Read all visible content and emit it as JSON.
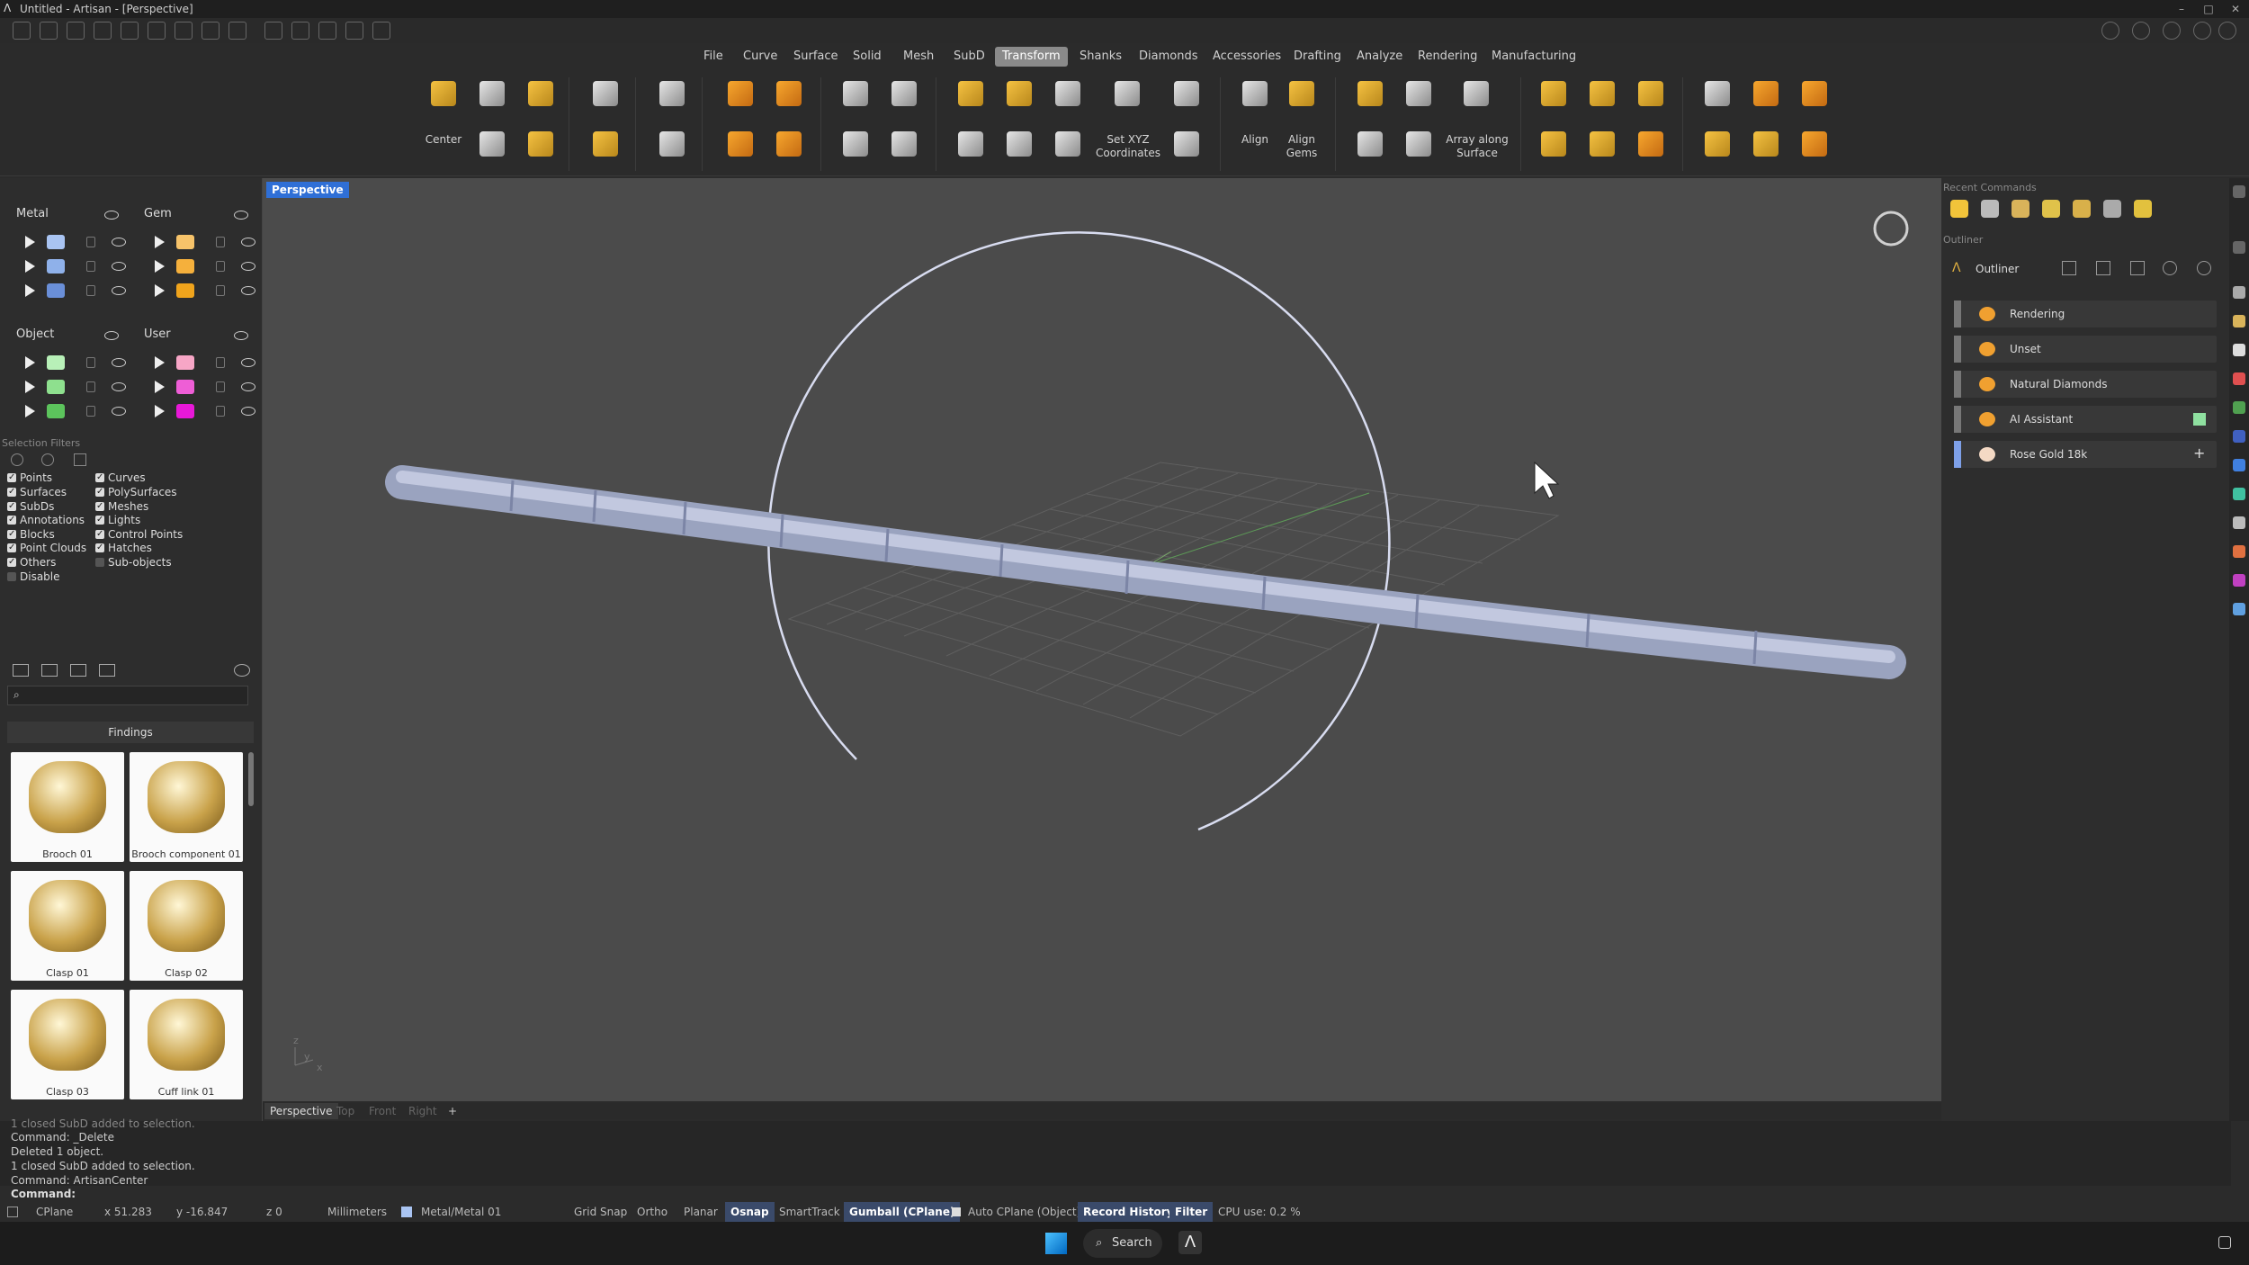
{
  "window": {
    "title": "Untitled - Artisan - [Perspective]"
  },
  "menu": {
    "items": [
      "File",
      "Curve",
      "Surface",
      "Solid",
      "Mesh",
      "SubD",
      "Transform",
      "Shanks",
      "Diamonds",
      "Accessories",
      "Drafting",
      "Analyze",
      "Rendering",
      "Manufacturing"
    ],
    "active": "Transform"
  },
  "ribbon": {
    "center_label": "Center",
    "setxyz_label1": "Set XYZ",
    "setxyz_label2": "Coordinates",
    "align_label": "Align",
    "aligngems_label1": "Align",
    "aligngems_label2": "Gems",
    "array_label1": "Array along",
    "array_label2": "Surface"
  },
  "layers": {
    "metal": {
      "title": "Metal",
      "swatches": [
        "#a9c4f2",
        "#8fb1ea",
        "#6a8fd8"
      ]
    },
    "gem": {
      "title": "Gem",
      "swatches": [
        "#f7c36a",
        "#f5b03c",
        "#f0a41c"
      ]
    },
    "object": {
      "title": "Object",
      "swatches": [
        "#b8f0b8",
        "#8ee08e",
        "#5cc45c"
      ]
    },
    "user": {
      "title": "User",
      "swatches": [
        "#f7a6c6",
        "#ee5ed6",
        "#e818d8"
      ]
    }
  },
  "selection_filters": {
    "title": "Selection Filters",
    "left": [
      {
        "label": "Points",
        "checked": true
      },
      {
        "label": "Surfaces",
        "checked": true
      },
      {
        "label": "SubDs",
        "checked": true
      },
      {
        "label": "Annotations",
        "checked": true
      },
      {
        "label": "Blocks",
        "checked": true
      },
      {
        "label": "Point Clouds",
        "checked": true
      },
      {
        "label": "Others",
        "checked": true
      },
      {
        "label": "Disable",
        "checked": false
      }
    ],
    "right": [
      {
        "label": "Curves",
        "checked": true
      },
      {
        "label": "PolySurfaces",
        "checked": true
      },
      {
        "label": "Meshes",
        "checked": true
      },
      {
        "label": "Lights",
        "checked": true
      },
      {
        "label": "Control Points",
        "checked": true
      },
      {
        "label": "Hatches",
        "checked": true
      },
      {
        "label": "Sub-objects",
        "checked": false
      }
    ]
  },
  "library": {
    "category": "Findings",
    "items": [
      "Brooch 01",
      "Brooch component 01",
      "Clasp 01",
      "Clasp 02",
      "Clasp 03",
      "Cuff link 01"
    ]
  },
  "viewport": {
    "label": "Perspective",
    "tabs": [
      "Perspective",
      "Top",
      "Front",
      "Right"
    ],
    "axis_y": "y",
    "axis_x": "x",
    "axis_z": "z"
  },
  "right_panel": {
    "recent_title": "Recent Commands",
    "outliner_title": "Outliner",
    "outliner_header": "Outliner",
    "rows": [
      {
        "label": "Rendering",
        "icon_color": "#f0a030"
      },
      {
        "label": "Unset",
        "icon_color": "#f0a030"
      },
      {
        "label": "Natural Diamonds",
        "icon_color": "#f0a030"
      },
      {
        "label": "AI Assistant",
        "icon_color": "#f0a030"
      },
      {
        "label": "Rose Gold 18k",
        "icon_color": "#f4d9c4"
      }
    ]
  },
  "command_history": [
    "1 closed SubD added to selection.",
    "Command: _Delete",
    "Deleted 1 object.",
    "1 closed SubD added to selection.",
    "Command: ArtisanCenter"
  ],
  "command_prompt": "Command:",
  "status": {
    "cplane": "CPlane",
    "x": "x 51.283",
    "y": "y -16.847",
    "z": "z 0",
    "units": "Millimeters",
    "layer": "Metal/Metal 01",
    "grid_snap": "Grid Snap",
    "ortho": "Ortho",
    "planar": "Planar",
    "osnap": "Osnap",
    "smarttrack": "SmartTrack",
    "gumball": "Gumball (CPlane)",
    "auto_cplane": "Auto CPlane (Object)",
    "record_history": "Record History",
    "filter": "Filter",
    "cpu": "CPU use: 0.2 %"
  },
  "taskbar": {
    "search": "Search"
  }
}
